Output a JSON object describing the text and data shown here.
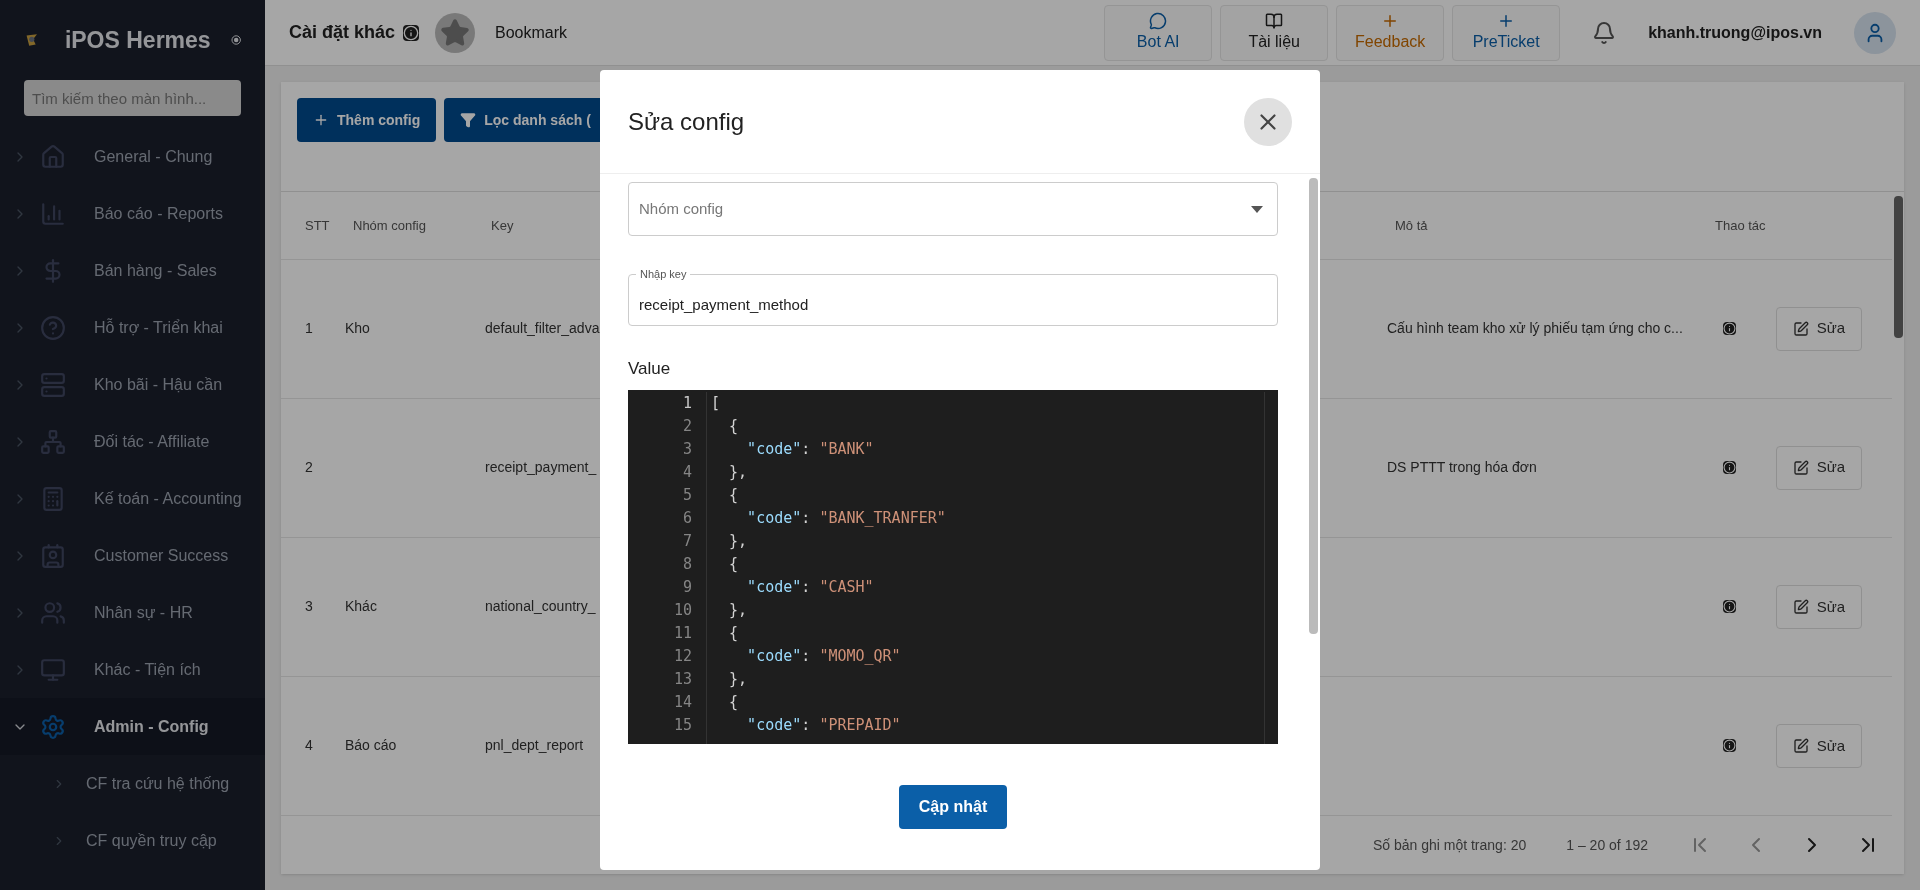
{
  "sidebar": {
    "title": "iPOS Hermes",
    "search": {
      "placeholder": "Tìm kiếm theo màn hình..."
    },
    "items": [
      {
        "label": "General - Chung",
        "expanded": false
      },
      {
        "label": "Báo cáo - Reports",
        "expanded": false
      },
      {
        "label": "Bán hàng - Sales",
        "expanded": false
      },
      {
        "label": "Hỗ trợ - Triển khai",
        "expanded": false
      },
      {
        "label": "Kho bãi - Hậu cần",
        "expanded": false
      },
      {
        "label": "Đối tác - Affiliate",
        "expanded": false
      },
      {
        "label": "Kế toán - Accounting",
        "expanded": false
      },
      {
        "label": "Customer Success",
        "expanded": false
      },
      {
        "label": "Nhân sự - HR",
        "expanded": false
      },
      {
        "label": "Khác - Tiện ích",
        "expanded": false
      },
      {
        "label": "Admin - Config",
        "expanded": true,
        "children": [
          {
            "label": "CF tra cứu hệ thống"
          },
          {
            "label": "CF quyền truy cập"
          }
        ]
      }
    ]
  },
  "header": {
    "page_title": "Cài đặt khác",
    "bookmark": "Bookmark",
    "buttons": [
      {
        "label": "Bot AI",
        "kind": "chat"
      },
      {
        "label": "Tài liệu",
        "kind": "book"
      },
      {
        "label": "Feedback",
        "kind": "feedback"
      },
      {
        "label": "PreTicket",
        "kind": "ticket"
      }
    ],
    "user": "khanh.truong@ipos.vn"
  },
  "toolbar": {
    "buttons": [
      {
        "label": "Thêm config",
        "kind": "add"
      },
      {
        "label": "Lọc danh sách (",
        "kind": "filter"
      }
    ]
  },
  "table": {
    "columns": [
      "STT",
      "Nhóm config",
      "Key",
      "Mô tả",
      "Thao tác"
    ],
    "rows": [
      {
        "stt": "1",
        "group": "Kho",
        "key": "default_filter_adva",
        "description": "Cấu hình team kho xử lý phiếu tạm ứng cho c...",
        "action": "Sửa"
      },
      {
        "stt": "2",
        "group": "",
        "key": "receipt_payment_",
        "description": "DS PTTT trong hóa đơn",
        "action": "Sửa"
      },
      {
        "stt": "3",
        "group": "Khác",
        "key": "national_country_",
        "description": "",
        "action": "Sửa"
      },
      {
        "stt": "4",
        "group": "Báo cáo",
        "key": "pnl_dept_report",
        "description": "",
        "action": "Sửa"
      }
    ]
  },
  "pagination": {
    "page_size_label": "Số bản ghi một trang:",
    "page_size": "20",
    "range": "1 – 20 of 192"
  },
  "dialog": {
    "title": "Sửa config",
    "group_field": {
      "placeholder": "Nhóm config"
    },
    "key_field": {
      "label": "Nhập key",
      "value": "receipt_payment_method"
    },
    "value_label": "Value",
    "code_lines": [
      {
        "number": "1",
        "kind": "punct",
        "text": "["
      },
      {
        "number": "2",
        "kind": "punct",
        "text": "  {"
      },
      {
        "number": "3",
        "kind": "pair",
        "key": "    \"code\"",
        "sep": ": ",
        "value": "\"BANK\""
      },
      {
        "number": "4",
        "kind": "punct",
        "text": "  },"
      },
      {
        "number": "5",
        "kind": "punct",
        "text": "  {"
      },
      {
        "number": "6",
        "kind": "pair",
        "key": "    \"code\"",
        "sep": ": ",
        "value": "\"BANK_TRANFER\""
      },
      {
        "number": "7",
        "kind": "punct",
        "text": "  },"
      },
      {
        "number": "8",
        "kind": "punct",
        "text": "  {"
      },
      {
        "number": "9",
        "kind": "pair",
        "key": "    \"code\"",
        "sep": ": ",
        "value": "\"CASH\""
      },
      {
        "number": "10",
        "kind": "punct",
        "text": "  },"
      },
      {
        "number": "11",
        "kind": "punct",
        "text": "  {"
      },
      {
        "number": "12",
        "kind": "pair",
        "key": "    \"code\"",
        "sep": ": ",
        "value": "\"MOMO_QR\""
      },
      {
        "number": "13",
        "kind": "punct",
        "text": "  },"
      },
      {
        "number": "14",
        "kind": "punct",
        "text": "  {"
      },
      {
        "number": "15",
        "kind": "pair",
        "key": "    \"code\"",
        "sep": ": ",
        "value": "\"PREPAID\""
      }
    ],
    "submit": "Cập nhật"
  }
}
